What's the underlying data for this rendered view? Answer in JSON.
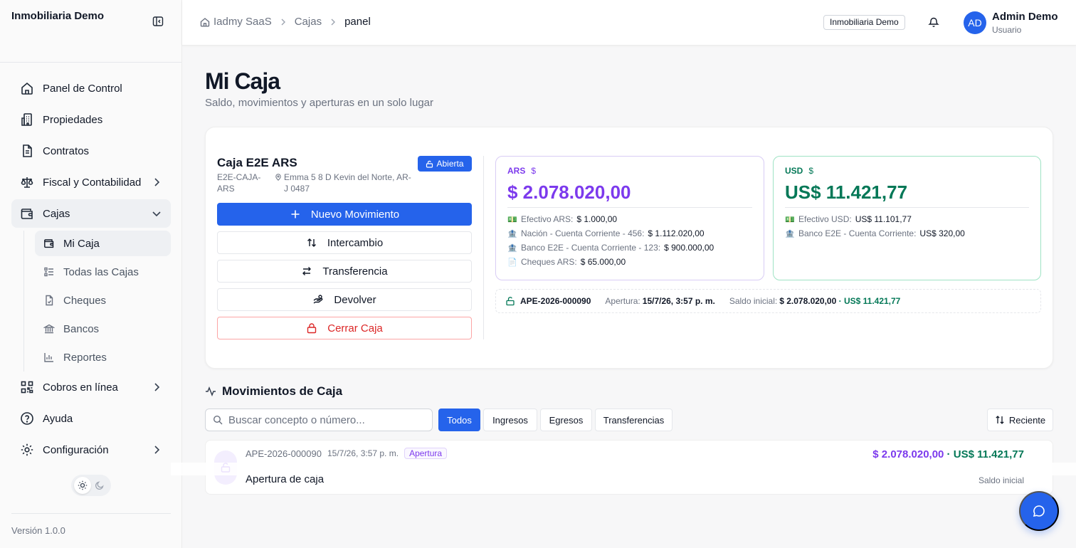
{
  "app": {
    "brand": "Inmobiliaria Demo",
    "version": "Versión 1.0.0"
  },
  "colors": {
    "primary": "#2563eb",
    "ars_accent": "#7c3aed",
    "usd_accent": "#047857",
    "danger": "#dc2626"
  },
  "sidebar": {
    "items": [
      {
        "label": "Panel de Control",
        "icon": "home-icon"
      },
      {
        "label": "Propiedades",
        "icon": "building-icon"
      },
      {
        "label": "Contratos",
        "icon": "file-text-icon"
      },
      {
        "label": "Fiscal y Contabilidad",
        "icon": "scale-icon"
      },
      {
        "label": "Cajas",
        "icon": "wallet-icon"
      },
      {
        "label": "Cobros en línea",
        "icon": "qr-code-icon"
      },
      {
        "label": "Ayuda",
        "icon": "help-circle-icon"
      },
      {
        "label": "Configuración",
        "icon": "gear-icon"
      }
    ],
    "subitems": [
      {
        "label": "Mi Caja",
        "icon": "wallet-icon"
      },
      {
        "label": "Todas las Cajas",
        "icon": "list-icon"
      },
      {
        "label": "Cheques",
        "icon": "file-icon"
      },
      {
        "label": "Bancos",
        "icon": "bank-icon"
      },
      {
        "label": "Reportes",
        "icon": "bar-chart-icon"
      }
    ]
  },
  "header": {
    "breadcrumb": [
      "Iadmy SaaS",
      "Cajas",
      "panel"
    ],
    "tenant": "Inmobiliaria Demo",
    "user_initials": "AD",
    "user_name": "Admin Demo",
    "user_role": "Usuario"
  },
  "page": {
    "title": "Mi Caja",
    "subtitle": "Saldo, movimientos y aperturas en un solo lugar"
  },
  "box": {
    "name": "Caja E2E ARS",
    "code": "E2E-CAJA-ARS",
    "address": "Emma 5 8 D Kevin del Norte, AR-J 0487",
    "status": "Abierta",
    "actions": {
      "new_movement": "Nuevo Movimiento",
      "exchange": "Intercambio",
      "transfer": "Transferencia",
      "return": "Devolver",
      "close": "Cerrar Caja"
    }
  },
  "balances": {
    "ars": {
      "currency": "ARS",
      "symbol": "$",
      "total": "$ 2.078.020,00",
      "accounts": [
        {
          "emoji": "💵",
          "label": "Efectivo ARS:",
          "amount": "$ 1.000,00"
        },
        {
          "emoji": "🏦",
          "label": "Nación - Cuenta Corriente - 456:",
          "amount": "$ 1.112.020,00"
        },
        {
          "emoji": "🏦",
          "label": "Banco E2E - Cuenta Corriente - 123:",
          "amount": "$ 900.000,00"
        },
        {
          "emoji": "📄",
          "label": "Cheques ARS:",
          "amount": "$ 65.000,00"
        }
      ]
    },
    "usd": {
      "currency": "USD",
      "symbol": "$",
      "total": "US$ 11.421,77",
      "accounts": [
        {
          "emoji": "💵",
          "label": "Efectivo USD:",
          "amount": "US$ 11.101,77"
        },
        {
          "emoji": "🏦",
          "label": "Banco E2E - Cuenta Corriente:",
          "amount": "US$ 320,00"
        }
      ]
    }
  },
  "opening": {
    "code": "APE-2026-000090",
    "opening_label": "Apertura:",
    "opening_value": "15/7/26, 3:57 p. m.",
    "initial_label": "Saldo inicial:",
    "initial_ars": "$ 2.078.020,00",
    "initial_sep": " · ",
    "initial_usd": "US$ 11.421,77"
  },
  "movements": {
    "title": "Movimientos de Caja",
    "search_placeholder": "Buscar concepto o número...",
    "filters": [
      "Todos",
      "Ingresos",
      "Egresos",
      "Transferencias"
    ],
    "active_filter": "Todos",
    "sort_label": "Reciente",
    "rows": [
      {
        "code": "APE-2026-000090",
        "date": "15/7/26, 3:57 p. m.",
        "tag": "Apertura",
        "concept": "Apertura de caja",
        "amount_ars": "$ 2.078.020,00",
        "amount_sep": " · ",
        "amount_usd": "US$ 11.421,77",
        "sub": "Saldo inicial"
      }
    ]
  }
}
